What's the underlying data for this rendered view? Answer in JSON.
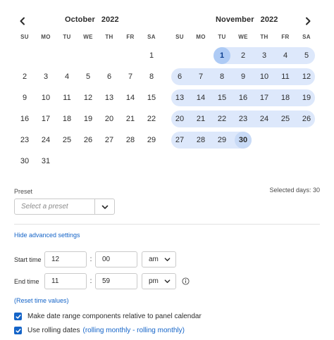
{
  "calendar": {
    "left": {
      "month": "October",
      "year": "2022",
      "weekdays": [
        "SU",
        "MO",
        "TU",
        "WE",
        "TH",
        "FR",
        "SA"
      ],
      "weeks": [
        [
          "",
          "",
          "",
          "",
          "",
          "",
          "1"
        ],
        [
          "2",
          "3",
          "4",
          "5",
          "6",
          "7",
          "8"
        ],
        [
          "9",
          "10",
          "11",
          "12",
          "13",
          "14",
          "15"
        ],
        [
          "16",
          "17",
          "18",
          "19",
          "20",
          "21",
          "22"
        ],
        [
          "23",
          "24",
          "25",
          "26",
          "27",
          "28",
          "29"
        ],
        [
          "30",
          "31",
          "",
          "",
          "",
          "",
          ""
        ]
      ]
    },
    "right": {
      "month": "November",
      "year": "2022",
      "weekdays": [
        "SU",
        "MO",
        "TU",
        "WE",
        "TH",
        "FR",
        "SA"
      ],
      "weeks": [
        [
          "",
          "",
          "1",
          "2",
          "3",
          "4",
          "5"
        ],
        [
          "6",
          "7",
          "8",
          "9",
          "10",
          "11",
          "12"
        ],
        [
          "13",
          "14",
          "15",
          "16",
          "17",
          "18",
          "19"
        ],
        [
          "20",
          "21",
          "22",
          "23",
          "24",
          "25",
          "26"
        ],
        [
          "27",
          "28",
          "29",
          "30",
          "",
          "",
          ""
        ]
      ]
    },
    "range": {
      "month": "November",
      "start_day": "1",
      "end_day": "30"
    },
    "prev_icon": "chevron-left-icon",
    "next_icon": "chevron-right-icon"
  },
  "preset": {
    "label": "Preset",
    "placeholder": "Select a preset",
    "dropdown_icon": "chevron-down-icon"
  },
  "selected_days": "Selected days: 30",
  "advanced": {
    "toggle_label": "Hide advanced settings",
    "start_time": {
      "label": "Start time",
      "hour": "12",
      "minute": "00",
      "period": "am"
    },
    "end_time": {
      "label": "End time",
      "hour": "11",
      "minute": "59",
      "period": "pm"
    },
    "separator": ":",
    "info_icon": "info-icon",
    "reset_label": "(Reset time values)",
    "options": [
      {
        "label": "Make date range components relative to panel calendar",
        "checked": true,
        "link": ""
      },
      {
        "label": "Use rolling dates",
        "checked": true,
        "link": "(rolling monthly - rolling monthly)"
      }
    ]
  },
  "colors": {
    "accent": "#1464c8",
    "range_fill": "#dde8fb",
    "range_start": "#aecbf5",
    "range_end": "#c8daf6"
  }
}
